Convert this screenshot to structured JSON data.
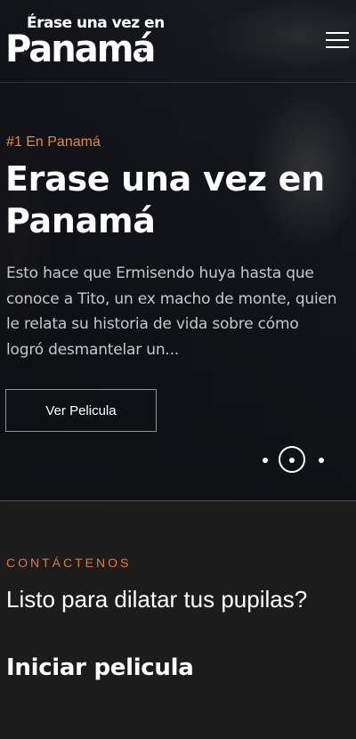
{
  "header": {
    "logo_small": "Érase una vez en",
    "logo_big": "Panamá",
    "menu_icon": "hamburger-menu-icon"
  },
  "hero": {
    "kicker": "#1 En Panamá",
    "title": "Erase una vez en Panamá",
    "description": "Esto hace que Ermisendo huya hasta que conoce a Tito, un ex macho de monte, quien le relata su historia de vida sobre cómo logró desmantelar un...",
    "cta_label": "Ver Pelicula",
    "slider": {
      "total": 3,
      "active": 2
    }
  },
  "contact": {
    "label": "CONTÁCTENOS",
    "heading": "Listo para dilatar tus pupilas?",
    "action": "Iniciar pelicula"
  },
  "colors": {
    "accent": "#e8893a",
    "background_dark": "#1c1c1c"
  }
}
